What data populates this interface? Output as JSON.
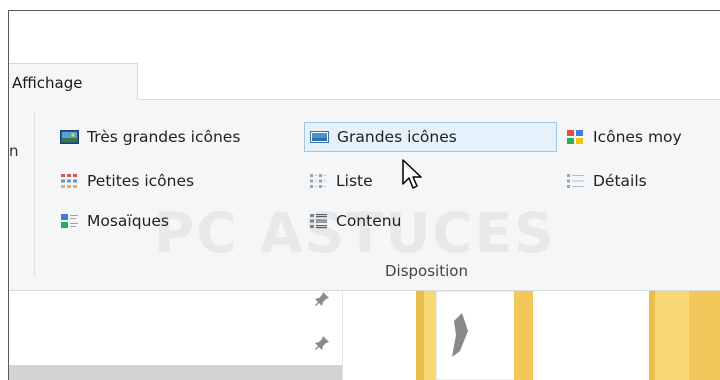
{
  "ribbon": {
    "tab_label": "Affichage",
    "left_fragment": "n",
    "layout_items": [
      {
        "label": "Très grandes icônes",
        "icon": "extra-large-icons-icon"
      },
      {
        "label": "Grandes icônes",
        "icon": "large-icons-icon",
        "selected": true
      },
      {
        "label": "Icônes moy",
        "icon": "medium-icons-icon"
      },
      {
        "label": "Petites icônes",
        "icon": "small-icons-icon"
      },
      {
        "label": "Liste",
        "icon": "list-icon"
      },
      {
        "label": "Détails",
        "icon": "details-icon"
      },
      {
        "label": "Mosaïques",
        "icon": "tiles-icon"
      },
      {
        "label": "Contenu",
        "icon": "content-icon"
      }
    ],
    "group_label": "Disposition"
  },
  "watermark": "PC ASTUCES",
  "colors": {
    "selected_bg": "#e5f1fb",
    "selected_border": "#9fc7ea",
    "ribbon_bg": "#f5f6f7",
    "folder": "#f8d775"
  }
}
